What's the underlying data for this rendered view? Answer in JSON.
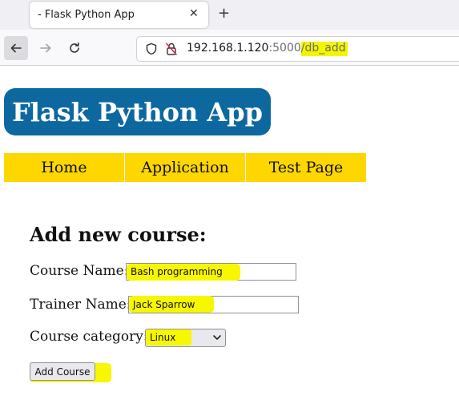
{
  "browser": {
    "tab_title": "- Flask Python App",
    "tab_close": "✕",
    "new_tab": "+",
    "url_host": "192.168.1.120",
    "url_port": ":5000",
    "url_path": "/db_add"
  },
  "page": {
    "brand": "Flask Python App",
    "menu": [
      "Home",
      "Application",
      "Test Page"
    ],
    "heading": "Add new course:",
    "course_name_label": "Course Name:",
    "course_name_value": "Bash programming",
    "trainer_name_label": "Trainer Name:",
    "trainer_name_value": "Jack Sparrow",
    "category_label": "Course category:",
    "category_value": "Linux",
    "submit_label": "Add Course"
  },
  "colors": {
    "brand_bg": "#0e68a0",
    "menu_bg": "#ffd700",
    "highlight": "#f7f700"
  }
}
